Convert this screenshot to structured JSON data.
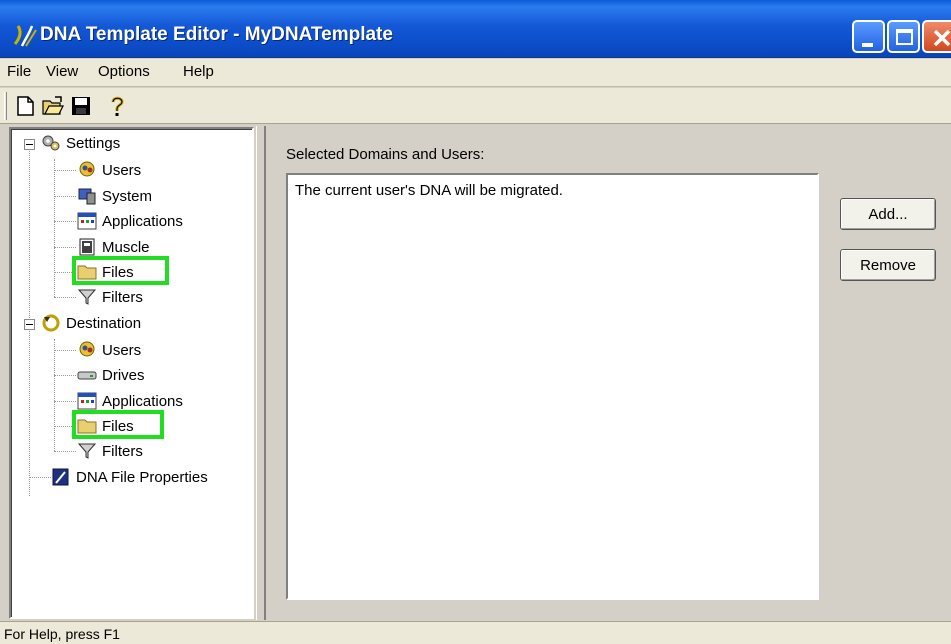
{
  "window": {
    "title": "DNA Template Editor - MyDNATemplate"
  },
  "menu": [
    "File",
    "View",
    "Options",
    "Help"
  ],
  "toolbar": {
    "icons": [
      "new-file-icon",
      "open-folder-icon",
      "save-icon",
      "help-icon"
    ]
  },
  "tree": {
    "settings": {
      "label": "Settings",
      "children": [
        "Users",
        "System",
        "Applications",
        "Muscle",
        "Files",
        "Filters"
      ]
    },
    "destination": {
      "label": "Destination",
      "children": [
        "Users",
        "Drives",
        "Applications",
        "Files",
        "Filters"
      ]
    },
    "dna_file_properties": "DNA File Properties",
    "highlight_color": "#22dd22"
  },
  "main": {
    "selected_label": "Selected Domains and Users:",
    "list_items": [
      "The current user's DNA will be migrated."
    ],
    "add_button": "Add...",
    "remove_button": "Remove"
  },
  "status": {
    "text": "For Help, press F1"
  }
}
